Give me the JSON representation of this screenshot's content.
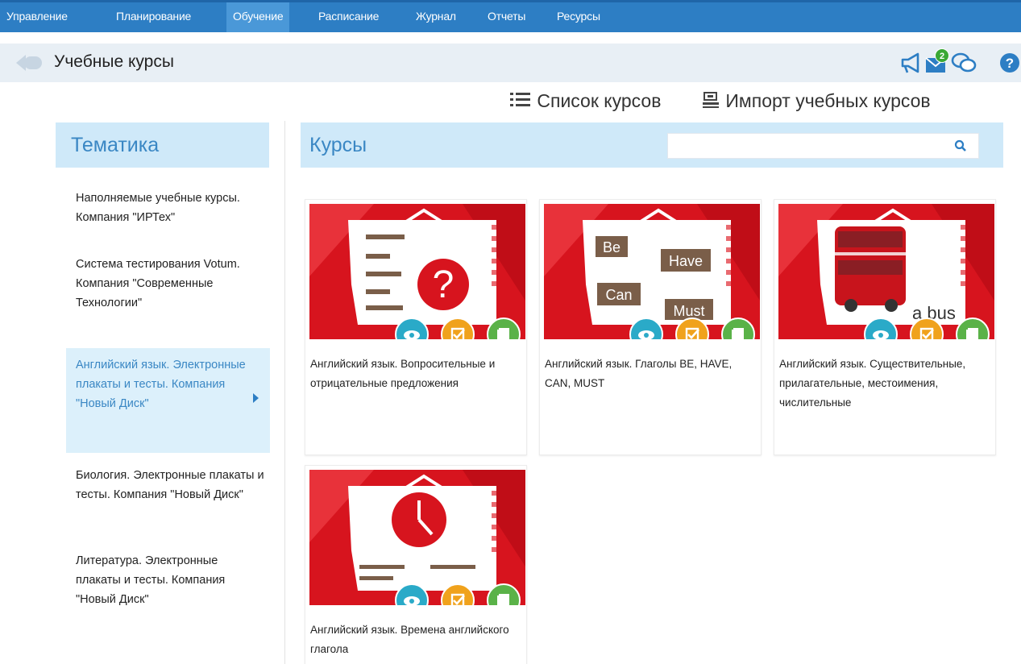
{
  "nav": {
    "items": [
      "Управление",
      "Планирование",
      "Обучение",
      "Расписание",
      "Журнал",
      "Отчеты",
      "Ресурсы"
    ],
    "active_index": 2
  },
  "header": {
    "title": "Учебные курсы",
    "notifications_count": "2"
  },
  "actions": {
    "course_list": "Список курсов",
    "import_courses": "Импорт учебных курсов"
  },
  "sidebar": {
    "title": "Тематика",
    "items": [
      "Наполняемые учебные курсы. Компания \"ИРТех\"",
      "Система тестирования Votum. Компания \"Современные Технологии\"",
      "Английский язык. Электронные плакаты и тесты. Компания \"Новый Диск\"",
      "Биология. Электронные плакаты и тесты. Компания \"Новый Диск\"",
      "Литература. Электронные плакаты и тесты. Компания \"Новый Диск\""
    ],
    "active_index": 2
  },
  "main": {
    "title": "Курсы",
    "search_placeholder": "",
    "courses": [
      {
        "title": "Английский язык. Вопросительные и отрицательные предложения",
        "thumb": "question"
      },
      {
        "title": "Английский язык. Глаголы BE, HAVE, CAN, MUST",
        "thumb": "verbs",
        "words": [
          "Be",
          "Have",
          "Can",
          "Must"
        ]
      },
      {
        "title": "Английский язык. Существительные, прилагательные, местоимения, числительные",
        "thumb": "bus",
        "caption_word": "a bus"
      },
      {
        "title": "Английский язык. Времена английского глагола",
        "thumb": "clock"
      }
    ]
  },
  "colors": {
    "nav": "#2d7ec4",
    "accent": "#3a87c4",
    "thumb_red": "#d7141e",
    "view": "#2aaac8",
    "edit": "#f0a21c",
    "copy": "#5ab248"
  },
  "icons": [
    "back-icon",
    "megaphone-icon",
    "mail-icon",
    "chat-icon",
    "help-icon",
    "list-icon",
    "import-icon",
    "search-icon",
    "eye-icon",
    "edit-icon",
    "copy-icon",
    "chevron-right-icon"
  ]
}
